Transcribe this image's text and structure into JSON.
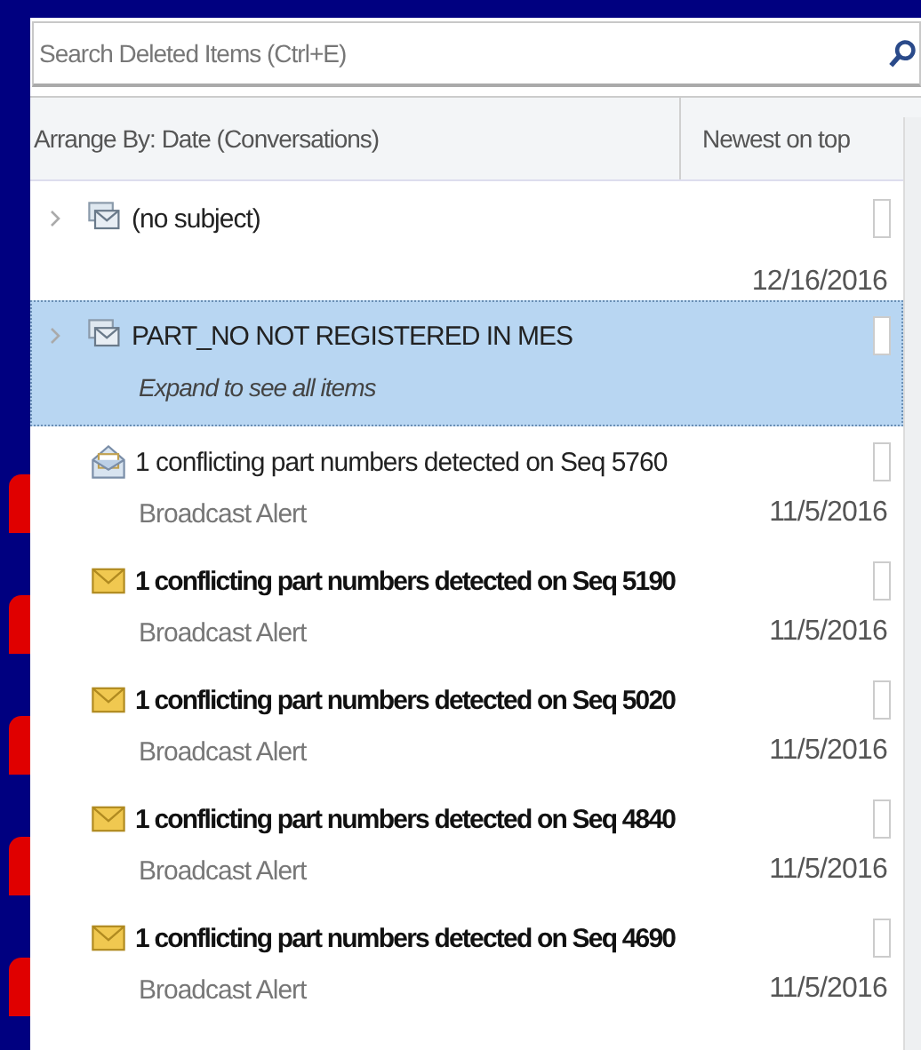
{
  "search": {
    "placeholder": "Search Deleted Items (Ctrl+E)"
  },
  "arrange": {
    "label": "Arrange By: Date (Conversations)",
    "order": "Newest on top"
  },
  "items": [
    {
      "kind": "conversation",
      "subject": "(no subject)",
      "date": "12/16/2016",
      "selected": false
    },
    {
      "kind": "conversation",
      "subject": "PART_NO NOT REGISTERED IN MES",
      "hint": "Expand to see all items",
      "selected": true
    },
    {
      "kind": "message",
      "subject": "1 conflicting part numbers detected on Seq 5760",
      "sender": "Broadcast Alert",
      "date": "11/5/2016",
      "unread": false,
      "selected": false
    },
    {
      "kind": "message",
      "subject": "1 conflicting part numbers detected on Seq 5190",
      "sender": "Broadcast Alert",
      "date": "11/5/2016",
      "unread": true,
      "selected": false
    },
    {
      "kind": "message",
      "subject": "1 conflicting part numbers detected on Seq 5020",
      "sender": "Broadcast Alert",
      "date": "11/5/2016",
      "unread": true,
      "selected": false
    },
    {
      "kind": "message",
      "subject": "1 conflicting part numbers detected on Seq 4840",
      "sender": "Broadcast Alert",
      "date": "11/5/2016",
      "unread": true,
      "selected": false
    },
    {
      "kind": "message",
      "subject": "1 conflicting part numbers detected on Seq 4690",
      "sender": "Broadcast Alert",
      "date": "11/5/2016",
      "unread": true,
      "selected": false
    }
  ]
}
